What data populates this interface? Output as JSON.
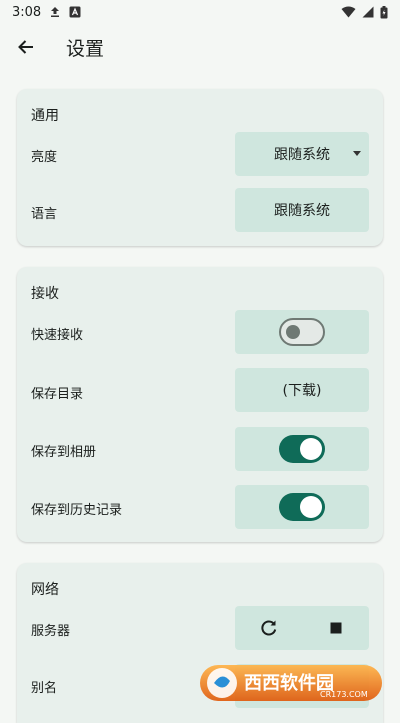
{
  "status_bar": {
    "time": "3:08"
  },
  "app_bar": {
    "title": "设置"
  },
  "general": {
    "title": "通用",
    "brightness": {
      "label": "亮度",
      "value": "跟随系统"
    },
    "language": {
      "label": "语言",
      "value": "跟随系统"
    }
  },
  "receive": {
    "title": "接收",
    "quick_receive": {
      "label": "快速接收",
      "enabled": false
    },
    "save_dir": {
      "label": "保存目录",
      "value": "(下载)"
    },
    "save_to_album": {
      "label": "保存到相册",
      "enabled": true
    },
    "save_history": {
      "label": "保存到历史记录",
      "enabled": true
    }
  },
  "network": {
    "title": "网络",
    "server": {
      "label": "服务器"
    },
    "alias": {
      "label": "别名"
    }
  },
  "watermark": {
    "text": "西西软件园",
    "sub": "CR173.COM"
  },
  "colors": {
    "background": "#f4f7f4",
    "card": "#e8f0ec",
    "control": "#cfe6de",
    "accent": "#0f6b58"
  }
}
